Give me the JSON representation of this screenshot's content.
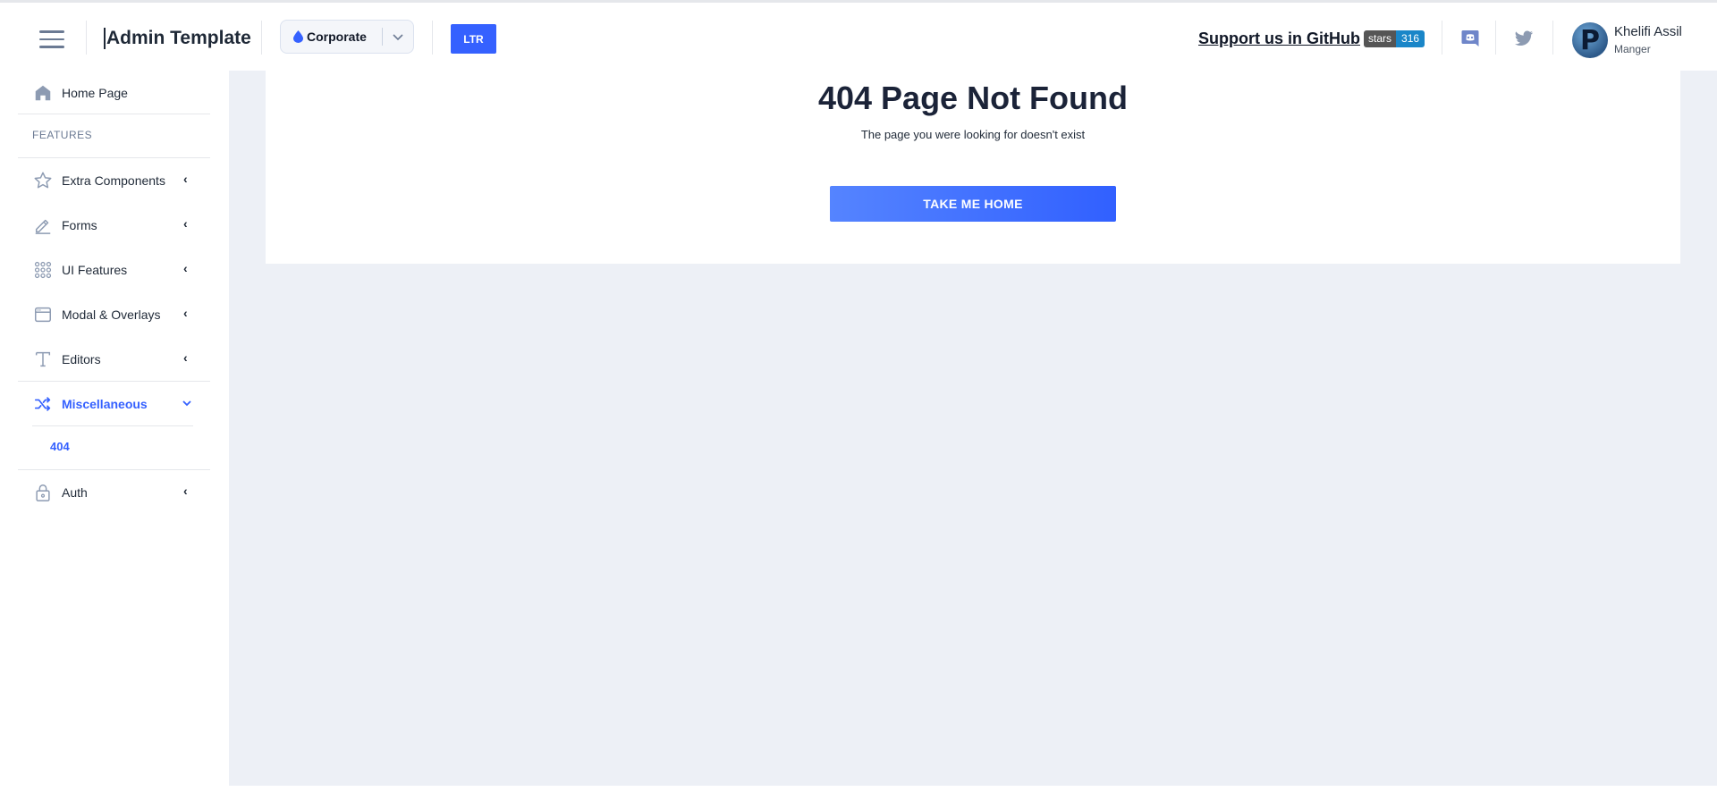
{
  "header": {
    "brand": "Admin Template",
    "theme_selected": "Corporate",
    "direction_label": "LTR",
    "support_text": "Support us in GitHub",
    "stars_label": "stars",
    "stars_count": "316",
    "user_initial": "P",
    "user_name": "Khelifi Assil",
    "user_role": "Manger"
  },
  "sidebar": {
    "section_title": "FEATURES",
    "items": [
      {
        "label": "Home Page",
        "icon": "home-icon"
      },
      {
        "label": "Extra Components",
        "icon": "star-icon"
      },
      {
        "label": "Forms",
        "icon": "pencil-icon"
      },
      {
        "label": "UI Features",
        "icon": "grid-dots-icon"
      },
      {
        "label": "Modal & Overlays",
        "icon": "window-icon"
      },
      {
        "label": "Editors",
        "icon": "text-t-icon"
      },
      {
        "label": "Miscellaneous",
        "icon": "shuffle-icon"
      },
      {
        "label": "Auth",
        "icon": "lock-icon"
      }
    ],
    "active_sub_item": "404"
  },
  "main": {
    "title": "404 Page Not Found",
    "subtitle": "The page you were looking for doesn't exist",
    "button_label": "TAKE ME HOME"
  },
  "colors": {
    "accent": "#3561ff",
    "main_bg": "#edf0f6",
    "text_dark": "#1b2338",
    "icon_gray": "#6b7a93"
  }
}
